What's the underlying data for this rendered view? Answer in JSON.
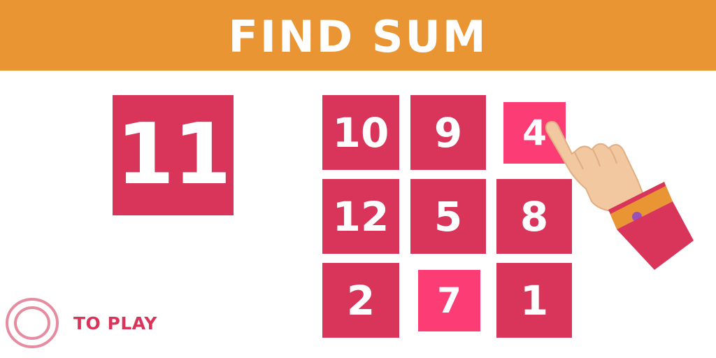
{
  "header": {
    "title": "FIND SUM"
  },
  "target": {
    "value": "11"
  },
  "grid": {
    "tiles": [
      {
        "value": "10",
        "selected": false
      },
      {
        "value": "9",
        "selected": false
      },
      {
        "value": "4",
        "selected": true
      },
      {
        "value": "12",
        "selected": false
      },
      {
        "value": "5",
        "selected": false
      },
      {
        "value": "8",
        "selected": false
      },
      {
        "value": "2",
        "selected": false
      },
      {
        "value": "7",
        "selected": true
      },
      {
        "value": "1",
        "selected": false
      }
    ]
  },
  "play": {
    "label": "TO PLAY"
  },
  "colors": {
    "header_bg": "#ea9534",
    "tile": "#d9345a",
    "tile_selected": "#fc3c74",
    "play_ring": "#e68ca0"
  },
  "icons": {
    "hand": "pointing-hand-icon",
    "play": "double-ring-icon"
  }
}
